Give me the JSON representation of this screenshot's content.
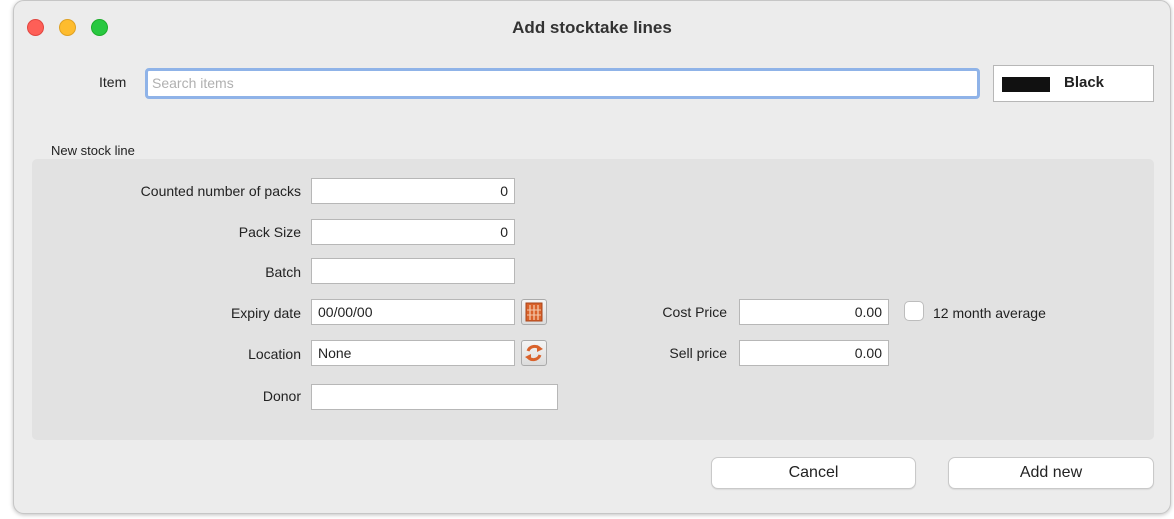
{
  "window": {
    "title": "Add stocktake lines"
  },
  "item": {
    "label": "Item",
    "search_placeholder": "Search items",
    "color_name": "Black",
    "color_swatch": "#111111"
  },
  "section": {
    "title": "New stock line"
  },
  "form": {
    "counted_packs": {
      "label": "Counted number of packs",
      "value": "0"
    },
    "pack_size": {
      "label": "Pack Size",
      "value": "0"
    },
    "batch": {
      "label": "Batch",
      "value": ""
    },
    "expiry_date": {
      "label": "Expiry date",
      "value": "00/00/00"
    },
    "location": {
      "label": "Location",
      "value": "None"
    },
    "donor": {
      "label": "Donor",
      "value": ""
    },
    "cost_price": {
      "label": "Cost Price",
      "value": "0.00"
    },
    "sell_price": {
      "label": "Sell price",
      "value": "0.00"
    },
    "average": {
      "label": "12 month average",
      "checked": false
    }
  },
  "buttons": {
    "cancel": "Cancel",
    "add_new": "Add new"
  },
  "icons": {
    "calendar": "calendar-icon",
    "location_refresh": "refresh-icon"
  },
  "colors": {
    "accent_focus": "#8fb3e8",
    "icon_orange": "#d9622b"
  }
}
